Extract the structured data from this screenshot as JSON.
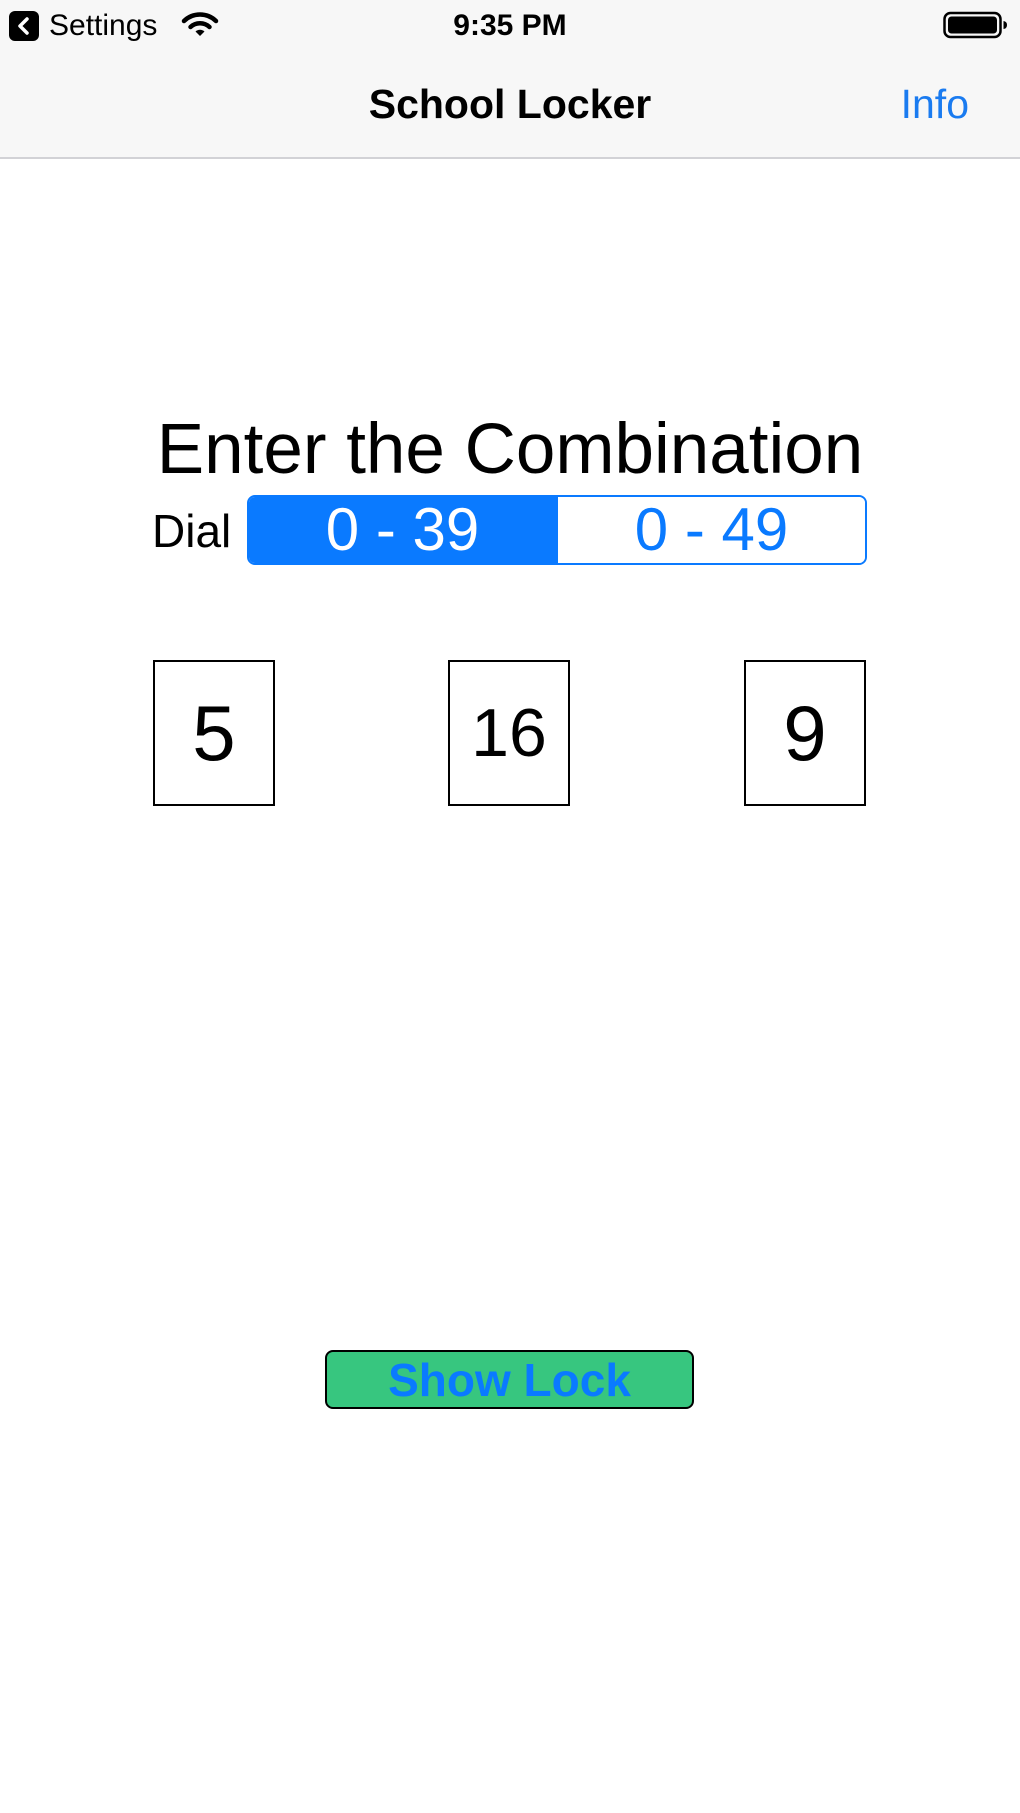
{
  "status_bar": {
    "back_app": "Settings",
    "time": "9:35 PM",
    "icons": [
      "back-arrow-icon",
      "wifi-icon",
      "battery-icon"
    ]
  },
  "nav": {
    "title": "School Locker",
    "info_label": "Info"
  },
  "main": {
    "heading": "Enter the Combination",
    "dial_label": "Dial",
    "segments": [
      {
        "label": "0 - 39",
        "selected": true
      },
      {
        "label": "0 - 49",
        "selected": false
      }
    ],
    "combination": [
      "5",
      "16",
      "9"
    ],
    "show_lock_label": "Show Lock"
  },
  "colors": {
    "accent": "#0a7aff",
    "button_green": "#37c67f",
    "nav_background": "#f7f7f7"
  }
}
